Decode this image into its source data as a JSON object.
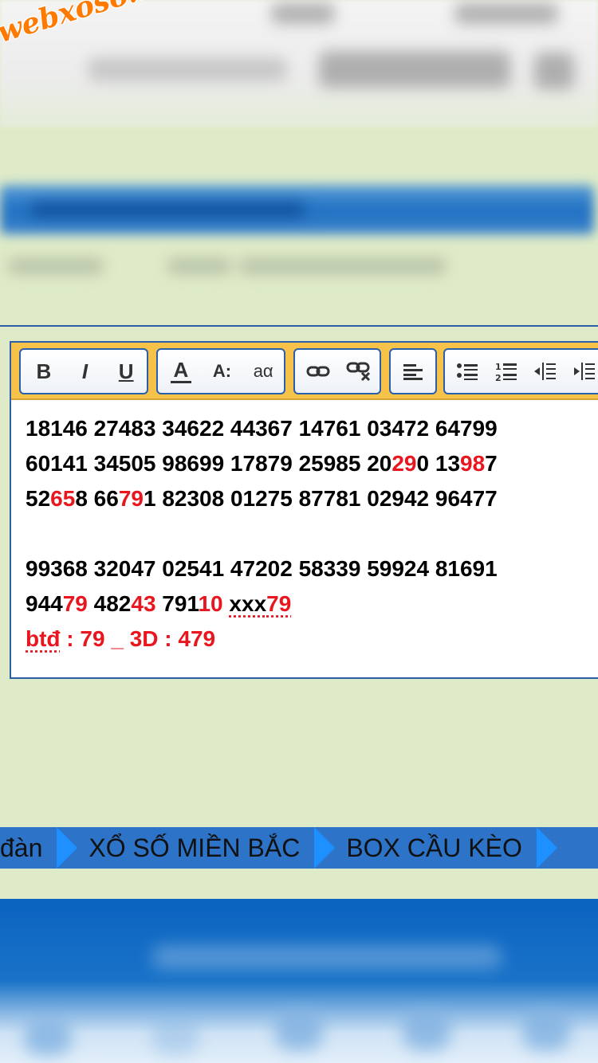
{
  "logo": {
    "text": "webxoso.net",
    "color": "#ff7a00"
  },
  "toolbar": {
    "groups": [
      {
        "items": [
          {
            "icon": "bold-icon",
            "label": "B"
          },
          {
            "icon": "italic-icon",
            "label": "I"
          },
          {
            "icon": "underline-icon",
            "label": "U"
          }
        ]
      },
      {
        "items": [
          {
            "icon": "font-color-icon",
            "label": "A"
          },
          {
            "icon": "font-size-icon",
            "label": "A:"
          },
          {
            "icon": "font-family-icon",
            "label": "aα"
          }
        ]
      },
      {
        "items": [
          {
            "icon": "link-icon"
          },
          {
            "icon": "unlink-icon"
          }
        ]
      },
      {
        "items": [
          {
            "icon": "align-left-icon"
          }
        ]
      },
      {
        "items": [
          {
            "icon": "bullet-list-icon"
          },
          {
            "icon": "numbered-list-icon"
          },
          {
            "icon": "outdent-icon"
          },
          {
            "icon": "indent-icon"
          }
        ]
      }
    ]
  },
  "content": {
    "lines": [
      [
        {
          "t": "18146 27483 34622 44367 14761 03472 64799"
        }
      ],
      [
        {
          "t": "60141 34505 98699 17879 25985 20"
        },
        {
          "t": "29",
          "red": true
        },
        {
          "t": "0 13"
        },
        {
          "t": "98",
          "red": true
        },
        {
          "t": "7"
        }
      ],
      [
        {
          "t": "52"
        },
        {
          "t": "65",
          "red": true
        },
        {
          "t": "8 66"
        },
        {
          "t": "79",
          "red": true
        },
        {
          "t": "1 82308 01275 87781 02942 96477"
        }
      ],
      [],
      [
        {
          "t": "99368 32047 02541 47202 58339 59924 81691"
        }
      ],
      [
        {
          "t": "944"
        },
        {
          "t": "79",
          "red": true
        },
        {
          "t": " 482"
        },
        {
          "t": "43",
          "red": true
        },
        {
          "t": " 791"
        },
        {
          "t": "10",
          "red": true
        },
        {
          "t": " "
        },
        {
          "t": "xxx",
          "squig": true
        },
        {
          "t": "79",
          "red": true,
          "squig": true
        }
      ],
      [
        {
          "t": "btđ",
          "red": true,
          "squig": true
        },
        {
          "t": " : 79 _ 3D : 479",
          "red": true
        }
      ]
    ]
  },
  "nav": {
    "items": [
      "đàn",
      "XỔ SỐ MIỀN BẮC",
      "BOX CẦU KÈO"
    ]
  },
  "colors": {
    "accent_red": "#e8161e",
    "nav_blue": "#2d74c8",
    "editor_border": "#2b5fa8",
    "toolbar_yellow": "#f6c24a"
  }
}
